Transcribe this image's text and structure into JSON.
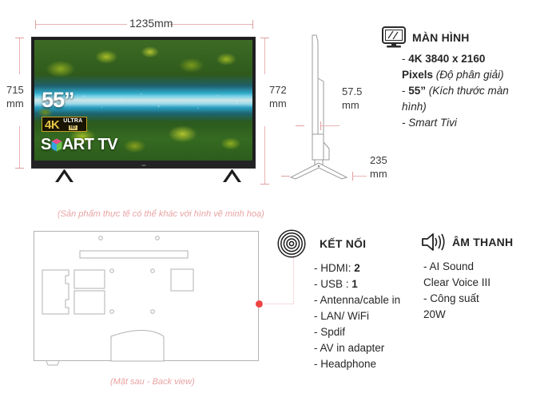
{
  "dimensions": {
    "width_label": "1235mm",
    "height_left_line1": "715",
    "height_left_line2": "mm",
    "height_right_line1": "772",
    "height_right_line2": "mm",
    "depth_line1": "57.5",
    "depth_line2": "mm",
    "stand_depth_line1": "235",
    "stand_depth_line2": "mm"
  },
  "tv_screen": {
    "size_badge": "55”",
    "badge_4k": "4K",
    "badge_ultra": "ULTRA",
    "badge_hd": "HD",
    "smart_tv_pre": "S",
    "smart_tv_post": "ART TV"
  },
  "captions": {
    "disclaimer": "(Sản phẩm thực tế có thể khác với hình vẽ minh hoạ)",
    "back_view": "(Mặt sau - Back view)"
  },
  "specs": {
    "display": {
      "icon": "monitor-icon",
      "title": "MÀN HÌNH",
      "lines": [
        {
          "plain": "- ",
          "bold": "4K 3840 x 2160"
        },
        {
          "bold": "Pixels",
          "italic": " (Độ phân giải)"
        },
        {
          "plain": "- ",
          "bold": "55”",
          "italic": " (Kích thước màn"
        },
        {
          "italic": "hình)"
        },
        {
          "italic": "- Smart Tivi"
        }
      ]
    },
    "connectivity": {
      "icon": "signal-waves-icon",
      "title": "KẾT NỐI",
      "lines": [
        {
          "plain": "- HDMI: ",
          "bold": "2"
        },
        {
          "plain": "- USB : ",
          "bold": "1"
        },
        {
          "plain": "- Antenna/cable in"
        },
        {
          "plain": "- LAN/ WiFi"
        },
        {
          "plain": "- Spdif"
        },
        {
          "plain": "- AV in adapter"
        },
        {
          "plain": "- Headphone"
        }
      ]
    },
    "audio": {
      "icon": "speaker-icon",
      "title": "ÂM THANH",
      "lines": [
        {
          "plain": "- AI Sound"
        },
        {
          "plain": "Clear Voice III"
        },
        {
          "plain": "- Công suất"
        },
        {
          "plain": "20W"
        }
      ]
    }
  },
  "colors": {
    "dimension_line": "#e9b3b3",
    "caption_text": "#e9a3a3",
    "connector_dot": "#ef4444",
    "text": "#262626"
  }
}
